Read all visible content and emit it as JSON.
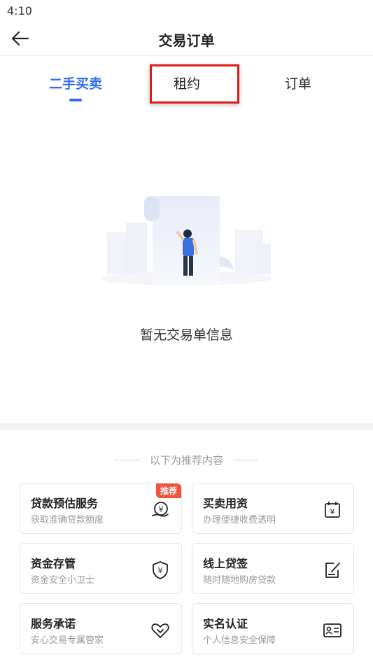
{
  "status_bar": {
    "time": "4:10"
  },
  "header": {
    "title": "交易订单"
  },
  "tabs": [
    {
      "label": "二手买卖",
      "active": true
    },
    {
      "label": "租约",
      "active": false
    },
    {
      "label": "订单",
      "active": false
    }
  ],
  "empty_state": {
    "message": "暂无交易单信息"
  },
  "recommend": {
    "title": "以下为推荐内容",
    "cards": [
      {
        "title": "贷款预估服务",
        "subtitle": "获取准确贷款额度",
        "icon": "loan-coin-icon",
        "badge": "推荐"
      },
      {
        "title": "买卖用资",
        "subtitle": "办理便捷收费透明",
        "icon": "calendar-yen-icon"
      },
      {
        "title": "资金存管",
        "subtitle": "资金安全小卫士",
        "icon": "shield-yen-icon"
      },
      {
        "title": "线上贷签",
        "subtitle": "随时随地购房贷款",
        "icon": "sign-document-icon"
      },
      {
        "title": "服务承诺",
        "subtitle": "安心交易专属管家",
        "icon": "heart-icon"
      },
      {
        "title": "实名认证",
        "subtitle": "个人信息安全保障",
        "icon": "id-card-icon"
      }
    ]
  },
  "colors": {
    "accent": "#2f6df0",
    "badge": "#f2543a",
    "highlight": "#e01b1b"
  }
}
